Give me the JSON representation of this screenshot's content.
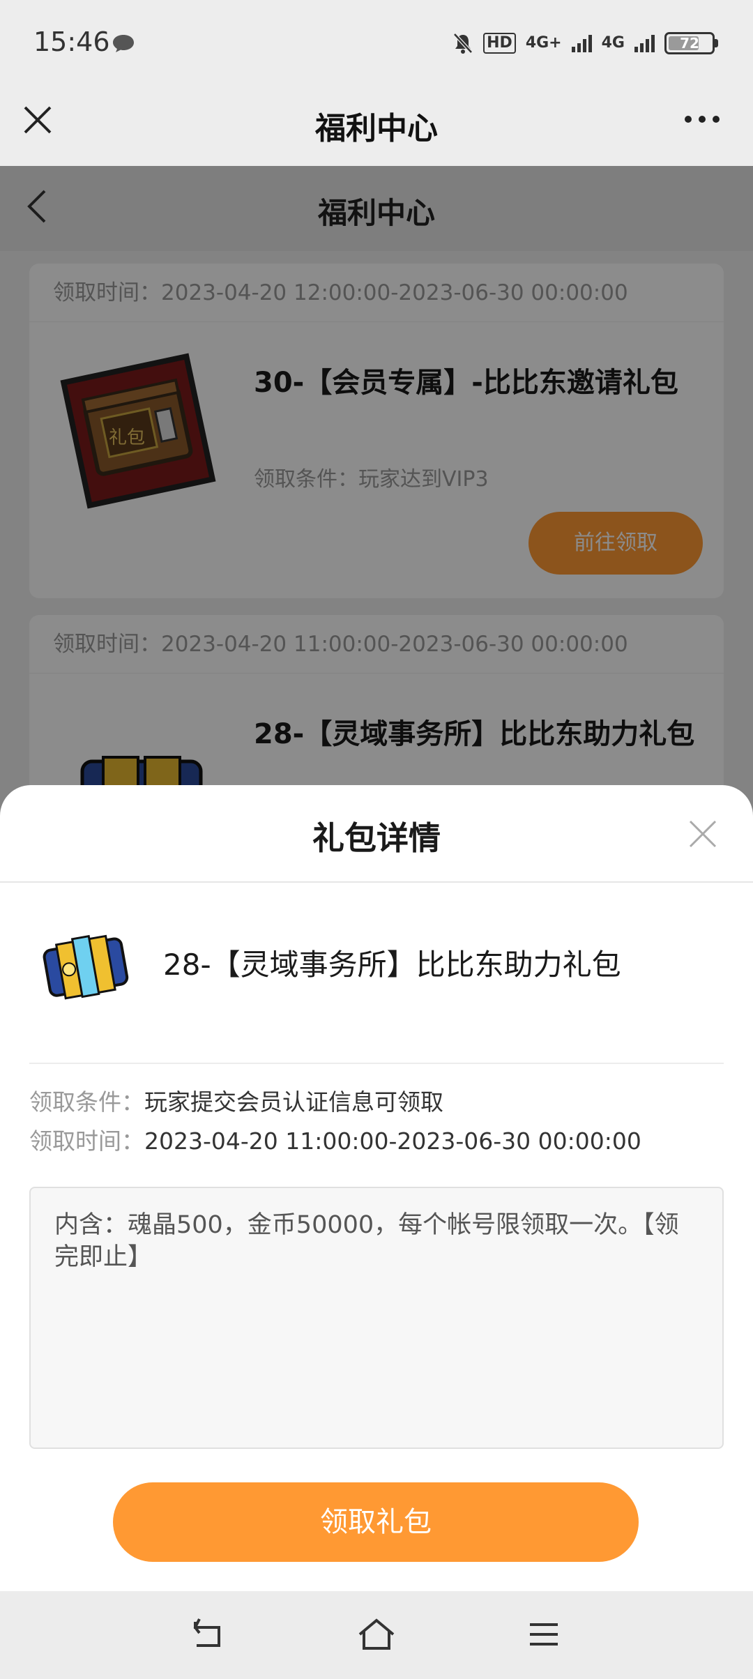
{
  "status_bar": {
    "time": "15:46",
    "hd_label": "HD",
    "network_1": "4G+",
    "network_2": "4G",
    "battery": "72"
  },
  "app_bar": {
    "title": "福利中心"
  },
  "page": {
    "title": "福利中心"
  },
  "cards": [
    {
      "time": "领取时间：2023-04-20 12:00:00-2023-06-30 00:00:00",
      "title": "30-【会员专属】-比比东邀请礼包",
      "condition": "领取条件：玩家达到VIP3",
      "button": "前往领取",
      "stamp": "礼包"
    },
    {
      "time": "领取时间：2023-04-20 11:00:00-2023-06-30 00:00:00",
      "title": "28-【灵域事务所】比比东助力礼包"
    }
  ],
  "sheet": {
    "title": "礼包详情",
    "gift_name": "28-【灵域事务所】比比东助力礼包",
    "condition_label": "领取条件：",
    "condition_value": "玩家提交会员认证信息可领取",
    "time_label": "领取时间：",
    "time_value": "2023-04-20 11:00:00-2023-06-30 00:00:00",
    "description": "内含：魂晶500，金币50000，每个帐号限领取一次。【领完即止】",
    "claim_button": "领取礼包"
  },
  "colors": {
    "accent": "#ff9933",
    "overlay": "rgba(0,0,0,0.45)"
  }
}
